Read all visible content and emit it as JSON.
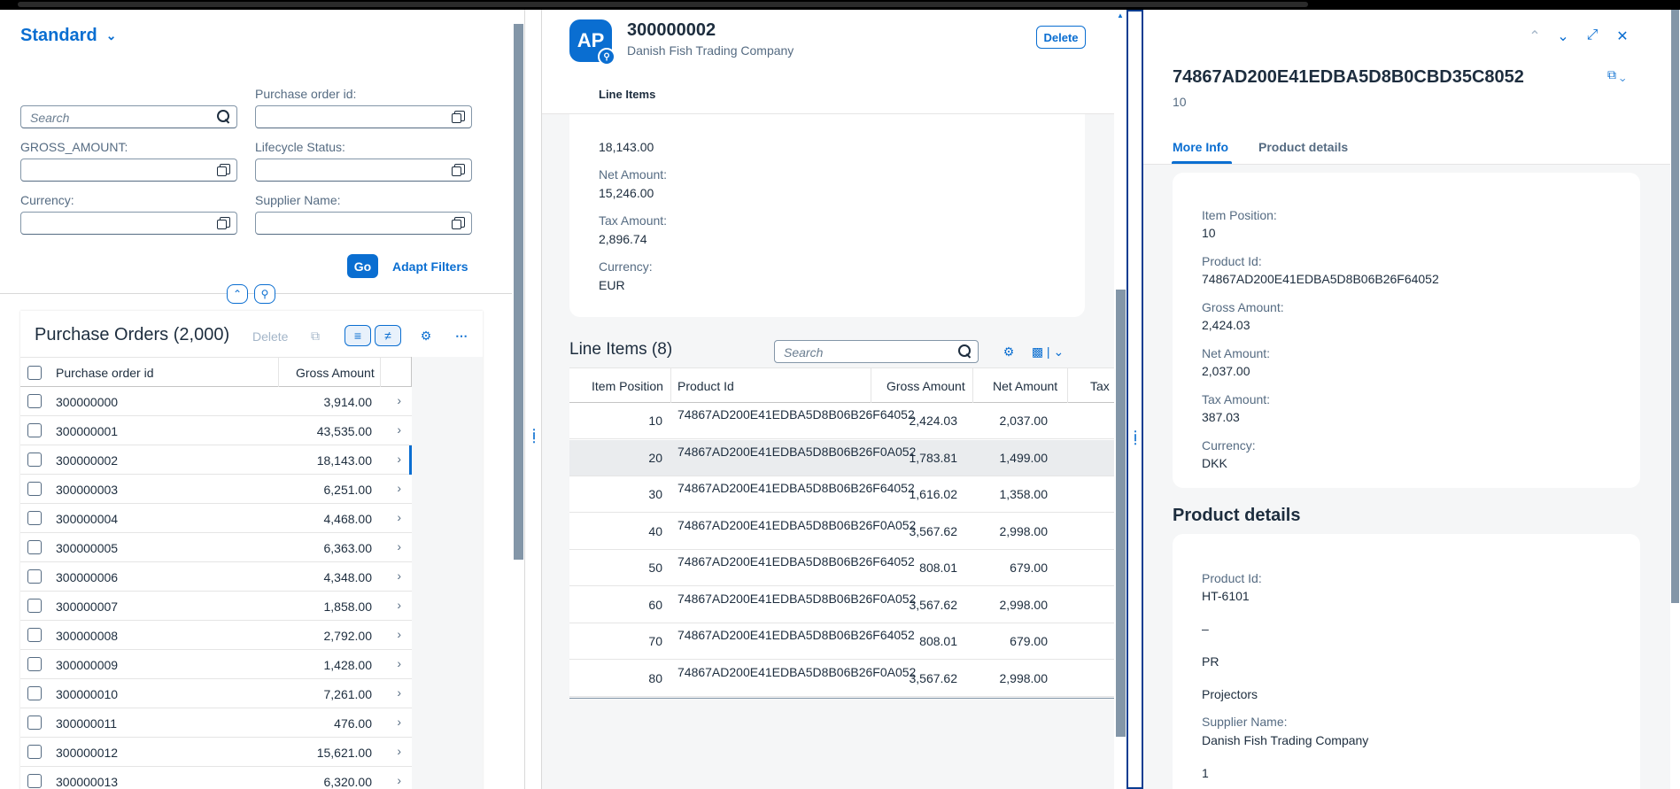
{
  "filter_bar": {
    "variant": "Standard",
    "search_placeholder": "Search",
    "fields": {
      "po_id": "Purchase order id:",
      "gross_amount": "GROSS_AMOUNT:",
      "lifecycle": "Lifecycle Status:",
      "currency": "Currency:",
      "supplier": "Supplier Name:"
    },
    "go": "Go",
    "adapt": "Adapt Filters"
  },
  "po_table": {
    "title": "Purchase Orders (2,000)",
    "delete": "Delete",
    "columns": [
      "Purchase order id",
      "Gross Amount"
    ],
    "rows": [
      {
        "id": "300000000",
        "gross": "3,914.00"
      },
      {
        "id": "300000001",
        "gross": "43,535.00"
      },
      {
        "id": "300000002",
        "gross": "18,143.00"
      },
      {
        "id": "300000003",
        "gross": "6,251.00"
      },
      {
        "id": "300000004",
        "gross": "4,468.00"
      },
      {
        "id": "300000005",
        "gross": "6,363.00"
      },
      {
        "id": "300000006",
        "gross": "4,348.00"
      },
      {
        "id": "300000007",
        "gross": "1,858.00"
      },
      {
        "id": "300000008",
        "gross": "2,792.00"
      },
      {
        "id": "300000009",
        "gross": "1,428.00"
      },
      {
        "id": "300000010",
        "gross": "7,261.00"
      },
      {
        "id": "300000011",
        "gross": "476.00"
      },
      {
        "id": "300000012",
        "gross": "15,621.00"
      },
      {
        "id": "300000013",
        "gross": "6,320.00"
      }
    ]
  },
  "object_page": {
    "avatar": "AP",
    "title": "300000002",
    "subtitle": "Danish Fish Trading Company",
    "delete": "Delete",
    "anchor": "Line Items",
    "gross_value": "18,143.00",
    "net_label": "Net Amount:",
    "net_value": "15,246.00",
    "tax_label": "Tax Amount:",
    "tax_value": "2,896.74",
    "currency_label": "Currency:",
    "currency_value": "EUR",
    "line_items_title": "Line Items (8)",
    "search_placeholder": "Search",
    "li_columns": [
      "Item Position",
      "Product Id",
      "Gross Amount",
      "Net Amount",
      "Tax"
    ],
    "li_rows": [
      {
        "pos": "10",
        "pid": "74867AD200E41EDBA5D8B06B26F64052",
        "gross": "2,424.03",
        "net": "2,037.00"
      },
      {
        "pos": "20",
        "pid": "74867AD200E41EDBA5D8B06B26F0A052",
        "gross": "1,783.81",
        "net": "1,499.00"
      },
      {
        "pos": "30",
        "pid": "74867AD200E41EDBA5D8B06B26F64052",
        "gross": "1,616.02",
        "net": "1,358.00"
      },
      {
        "pos": "40",
        "pid": "74867AD200E41EDBA5D8B06B26F0A052",
        "gross": "3,567.62",
        "net": "2,998.00"
      },
      {
        "pos": "50",
        "pid": "74867AD200E41EDBA5D8B06B26F64052",
        "gross": "808.01",
        "net": "679.00"
      },
      {
        "pos": "60",
        "pid": "74867AD200E41EDBA5D8B06B26F0A052",
        "gross": "3,567.62",
        "net": "2,998.00"
      },
      {
        "pos": "70",
        "pid": "74867AD200E41EDBA5D8B06B26F64052",
        "gross": "808.01",
        "net": "679.00"
      },
      {
        "pos": "80",
        "pid": "74867AD200E41EDBA5D8B06B26F0A052",
        "gross": "3,567.62",
        "net": "2,998.00"
      }
    ]
  },
  "item_page": {
    "title": "74867AD200E41EDBA5D8B0CBD35C8052",
    "subtitle": "10",
    "tabs": [
      "More Info",
      "Product details"
    ],
    "more_info": [
      {
        "k": "Item Position:",
        "v": "10"
      },
      {
        "k": "Product Id:",
        "v": "74867AD200E41EDBA5D8B06B26F64052"
      },
      {
        "k": "Gross Amount:",
        "v": "2,424.03"
      },
      {
        "k": "Net Amount:",
        "v": "2,037.00"
      },
      {
        "k": "Tax Amount:",
        "v": "387.03"
      },
      {
        "k": "Currency:",
        "v": "DKK"
      }
    ],
    "product_section": "Product details",
    "product_id_label": "Product Id:",
    "product_id": "HT-6101",
    "dash": "–",
    "category_code": "PR",
    "category": "Projectors",
    "supplier_label": "Supplier Name:",
    "supplier": "Danish Fish Trading Company",
    "last_value": "1"
  }
}
